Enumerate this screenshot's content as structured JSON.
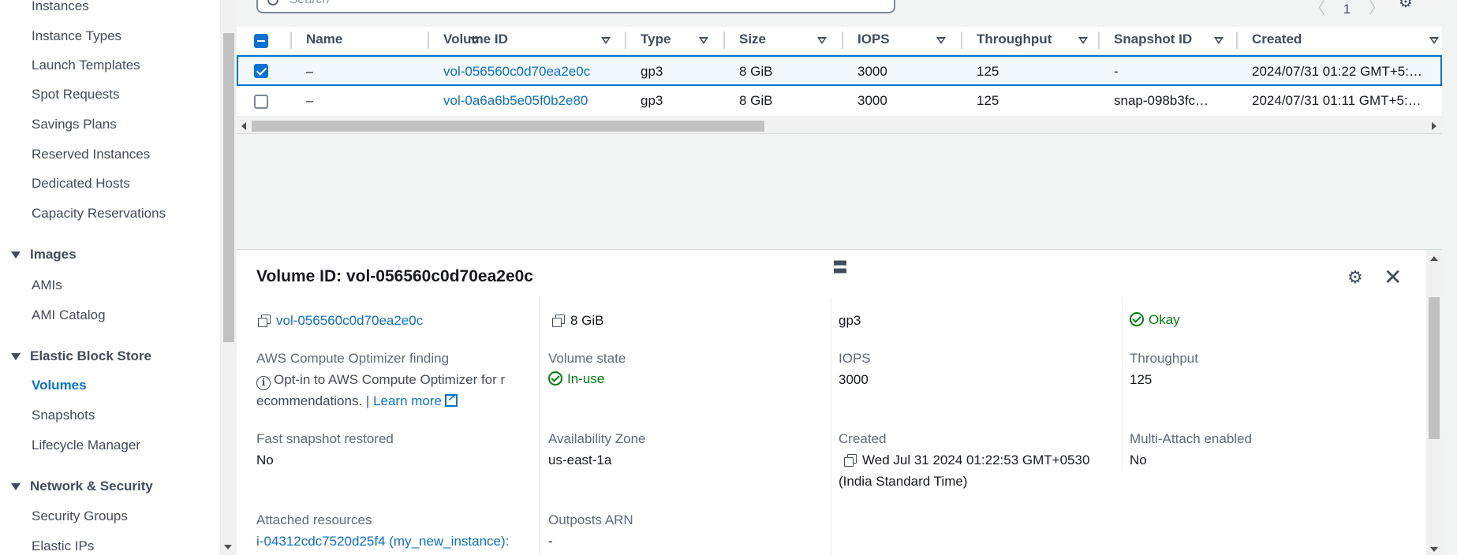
{
  "sidebar": {
    "items": [
      {
        "label": "Instances"
      },
      {
        "label": "Instance Types"
      },
      {
        "label": "Launch Templates"
      },
      {
        "label": "Spot Requests"
      },
      {
        "label": "Savings Plans"
      },
      {
        "label": "Reserved Instances"
      },
      {
        "label": "Dedicated Hosts"
      },
      {
        "label": "Capacity Reservations"
      }
    ],
    "images_section": "Images",
    "images_items": [
      {
        "label": "AMIs"
      },
      {
        "label": "AMI Catalog"
      }
    ],
    "ebs_section": "Elastic Block Store",
    "ebs_items": [
      {
        "label": "Volumes"
      },
      {
        "label": "Snapshots"
      },
      {
        "label": "Lifecycle Manager"
      }
    ],
    "network_section": "Network & Security",
    "network_items": [
      {
        "label": "Security Groups"
      },
      {
        "label": "Elastic IPs"
      }
    ]
  },
  "search": {
    "placeholder": "Search"
  },
  "pager": {
    "page": "1"
  },
  "table": {
    "columns": [
      "Name",
      "Volume ID",
      "Type",
      "Size",
      "IOPS",
      "Throughput",
      "Snapshot ID",
      "Created"
    ],
    "rows": [
      {
        "name": "–",
        "volume_id": "vol-056560c0d70ea2e0c",
        "type": "gp3",
        "size": "8 GiB",
        "iops": "3000",
        "throughput": "125",
        "snapshot_id": "-",
        "created": "2024/07/31 01:22 GMT+5:…",
        "selected": true
      },
      {
        "name": "–",
        "volume_id": "vol-0a6a6b5e05f0b2e80",
        "type": "gp3",
        "size": "8 GiB",
        "iops": "3000",
        "throughput": "125",
        "snapshot_id": "snap-098b3fc…",
        "created": "2024/07/31 01:11 GMT+5:…",
        "selected": false
      }
    ]
  },
  "details": {
    "title": "Volume ID: vol-056560c0d70ea2e0c",
    "volume_id": "vol-056560c0d70ea2e0c",
    "size": "8 GiB",
    "type": "gp3",
    "status": "Okay",
    "optimizer_label": "AWS Compute Optimizer finding",
    "optimizer_text_1": "Opt-in to AWS Compute Optimizer for r",
    "optimizer_text_2": "ecommendations. |",
    "learn_more": "Learn more",
    "volume_state_label": "Volume state",
    "volume_state": "In-use",
    "iops_label": "IOPS",
    "iops": "3000",
    "throughput_label": "Throughput",
    "throughput": "125",
    "fast_snapshot_label": "Fast snapshot restored",
    "fast_snapshot": "No",
    "az_label": "Availability Zone",
    "az": "us-east-1a",
    "created_label": "Created",
    "created_1": "Wed Jul 31 2024 01:22:53 GMT+0530",
    "created_2": "(India Standard Time)",
    "multi_attach_label": "Multi-Attach enabled",
    "multi_attach": "No",
    "attached_label": "Attached resources",
    "attached": "i-04312cdc7520d25f4 (my_new_instance):",
    "outposts_label": "Outposts ARN",
    "outposts": "-"
  }
}
